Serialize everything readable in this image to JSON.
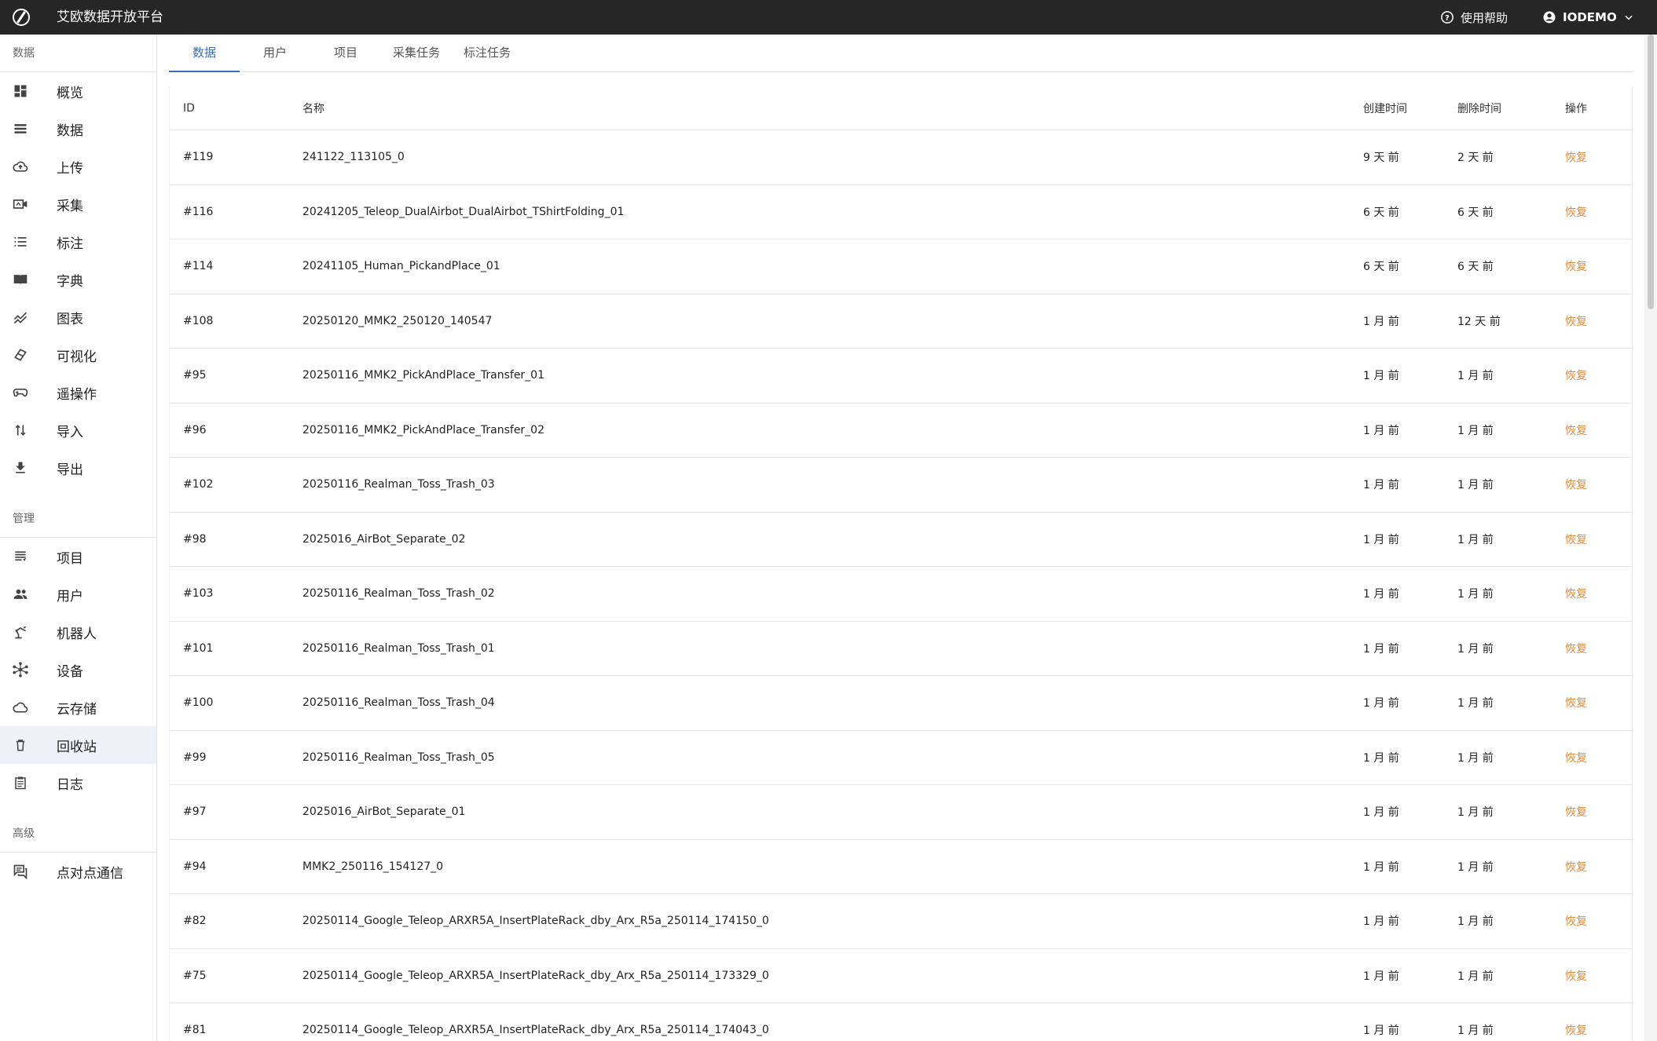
{
  "header": {
    "title": "艾欧数据开放平台",
    "help_label": "使用帮助",
    "user_label": "IODEMO",
    "logo_icon": "logo-slash-icon",
    "help_icon": "help-circle-icon",
    "user_icon": "account-circle-icon",
    "caret_icon": "chevron-down-icon"
  },
  "sidebar": {
    "sections": {
      "data": "数据",
      "manage": "管理",
      "advanced": "高级"
    },
    "data_items": [
      {
        "label": "概览",
        "icon": "dashboard-icon"
      },
      {
        "label": "数据",
        "icon": "list-icon"
      },
      {
        "label": "上传",
        "icon": "cloud-upload-icon"
      },
      {
        "label": "采集",
        "icon": "video-camera-icon"
      },
      {
        "label": "标注",
        "icon": "numbered-list-icon"
      },
      {
        "label": "字典",
        "icon": "book-icon"
      },
      {
        "label": "图表",
        "icon": "chart-line-icon"
      },
      {
        "label": "可视化",
        "icon": "visualize-icon"
      },
      {
        "label": "遥操作",
        "icon": "gamepad-icon"
      },
      {
        "label": "导入",
        "icon": "import-arrows-icon"
      },
      {
        "label": "导出",
        "icon": "download-icon"
      }
    ],
    "manage_items": [
      {
        "label": "项目",
        "icon": "project-icon"
      },
      {
        "label": "用户",
        "icon": "users-icon"
      },
      {
        "label": "机器人",
        "icon": "robot-arm-icon"
      },
      {
        "label": "设备",
        "icon": "device-hub-icon"
      },
      {
        "label": "云存储",
        "icon": "cloud-icon"
      },
      {
        "label": "回收站",
        "icon": "trash-icon"
      },
      {
        "label": "日志",
        "icon": "log-clipboard-icon"
      }
    ],
    "advanced_items": [
      {
        "label": "点对点通信",
        "icon": "chat-icon"
      }
    ]
  },
  "tabs": [
    "数据",
    "用户",
    "项目",
    "采集任务",
    "标注任务"
  ],
  "table": {
    "headers": {
      "id": "ID",
      "name": "名称",
      "created": "创建时间",
      "deleted": "删除时间",
      "op": "操作"
    },
    "restore_label": "恢复",
    "rows": [
      {
        "id": "#119",
        "name": "241122_113105_0",
        "created": "9 天 前",
        "deleted": "2 天 前"
      },
      {
        "id": "#116",
        "name": "20241205_Teleop_DualAirbot_DualAirbot_TShirtFolding_01",
        "created": "6 天 前",
        "deleted": "6 天 前"
      },
      {
        "id": "#114",
        "name": "20241105_Human_PickandPlace_01",
        "created": "6 天 前",
        "deleted": "6 天 前"
      },
      {
        "id": "#108",
        "name": "20250120_MMK2_250120_140547",
        "created": "1 月 前",
        "deleted": "12 天 前"
      },
      {
        "id": "#95",
        "name": "20250116_MMK2_PickAndPlace_Transfer_01",
        "created": "1 月 前",
        "deleted": "1 月 前"
      },
      {
        "id": "#96",
        "name": "20250116_MMK2_PickAndPlace_Transfer_02",
        "created": "1 月 前",
        "deleted": "1 月 前"
      },
      {
        "id": "#102",
        "name": "20250116_Realman_Toss_Trash_03",
        "created": "1 月 前",
        "deleted": "1 月 前"
      },
      {
        "id": "#98",
        "name": "2025016_AirBot_Separate_02",
        "created": "1 月 前",
        "deleted": "1 月 前"
      },
      {
        "id": "#103",
        "name": "20250116_Realman_Toss_Trash_02",
        "created": "1 月 前",
        "deleted": "1 月 前"
      },
      {
        "id": "#101",
        "name": "20250116_Realman_Toss_Trash_01",
        "created": "1 月 前",
        "deleted": "1 月 前"
      },
      {
        "id": "#100",
        "name": "20250116_Realman_Toss_Trash_04",
        "created": "1 月 前",
        "deleted": "1 月 前"
      },
      {
        "id": "#99",
        "name": "20250116_Realman_Toss_Trash_05",
        "created": "1 月 前",
        "deleted": "1 月 前"
      },
      {
        "id": "#97",
        "name": "2025016_AirBot_Separate_01",
        "created": "1 月 前",
        "deleted": "1 月 前"
      },
      {
        "id": "#94",
        "name": "MMK2_250116_154127_0",
        "created": "1 月 前",
        "deleted": "1 月 前"
      },
      {
        "id": "#82",
        "name": "20250114_Google_Teleop_ARXR5A_InsertPlateRack_dby_Arx_R5a_250114_174150_0",
        "created": "1 月 前",
        "deleted": "1 月 前"
      },
      {
        "id": "#75",
        "name": "20250114_Google_Teleop_ARXR5A_InsertPlateRack_dby_Arx_R5a_250114_173329_0",
        "created": "1 月 前",
        "deleted": "1 月 前"
      },
      {
        "id": "#81",
        "name": "20250114_Google_Teleop_ARXR5A_InsertPlateRack_dby_Arx_R5a_250114_174043_0",
        "created": "1 月 前",
        "deleted": "1 月 前"
      }
    ]
  },
  "colors": {
    "accent": "#3b6fb6",
    "restore": "#e08a3c",
    "topbar": "#262626"
  }
}
